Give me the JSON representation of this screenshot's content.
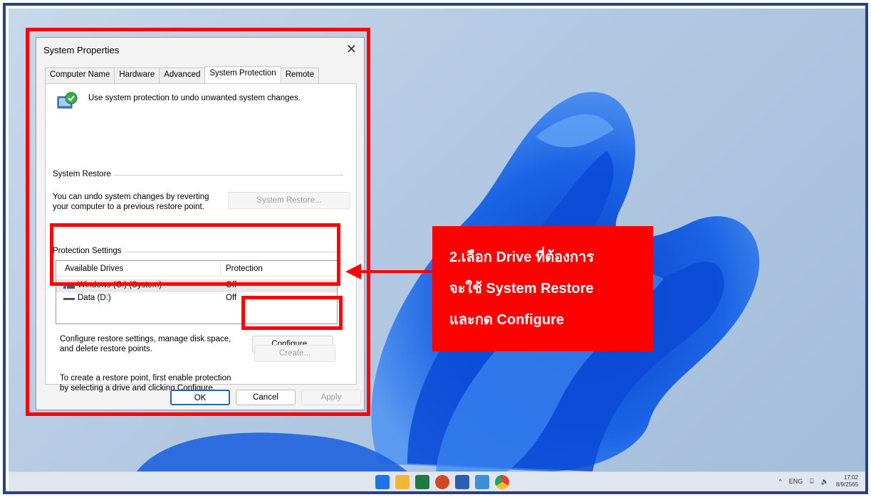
{
  "dialog": {
    "title": "System Properties",
    "close_glyph": "✕",
    "tabs": [
      {
        "label": "Computer Name"
      },
      {
        "label": "Hardware"
      },
      {
        "label": "Advanced"
      },
      {
        "label": "System Protection",
        "active": true
      },
      {
        "label": "Remote"
      }
    ],
    "intro": "Use system protection to undo unwanted system changes.",
    "system_restore": {
      "label": "System Restore",
      "description_line1": "You can undo system changes by reverting",
      "description_line2": "your computer to a previous restore point.",
      "button": "System Restore..."
    },
    "protection": {
      "label": "Protection Settings",
      "columns": {
        "drives": "Available Drives",
        "protection": "Protection"
      },
      "drives": [
        {
          "name": "Windows (C:) (System)",
          "protection": "Off",
          "selected": true
        },
        {
          "name": "Data (D:)",
          "protection": "Off",
          "selected": false
        }
      ]
    },
    "configure": {
      "line1": "Configure restore settings, manage disk space,",
      "line2": "and delete restore points.",
      "button": "Configure..."
    },
    "create": {
      "line1": "To create a restore point, first enable protection",
      "line2": "by selecting a drive and clicking Configure.",
      "button": "Create..."
    },
    "footer": {
      "ok": "OK",
      "cancel": "Cancel",
      "apply": "Apply"
    }
  },
  "annotation": {
    "line1": "2.เลือก Drive ที่ต้องการ",
    "line2": "จะใช้ System Restore",
    "line3": "และกด Configure",
    "color": "#ff0000"
  },
  "taskbar": {
    "apps": [
      {
        "icon": "windows-start-icon",
        "color": "#1e73e8"
      },
      {
        "icon": "file-explorer-icon",
        "color": "#f2b632"
      },
      {
        "icon": "excel-icon",
        "color": "#1d7a45"
      },
      {
        "icon": "powerpoint-icon",
        "color": "#d24726"
      },
      {
        "icon": "word-icon",
        "color": "#2b5fb4"
      },
      {
        "icon": "photos-icon",
        "color": "#3c8fd8"
      },
      {
        "icon": "chrome-icon",
        "color": "#e84235"
      }
    ],
    "tray_chevron": "^",
    "language": "ENG",
    "time": "17:02",
    "date": "8/9/2565"
  },
  "colors": {
    "frame": "#27408b",
    "bloom": "#1552d9",
    "accent": "#2a63c7"
  }
}
